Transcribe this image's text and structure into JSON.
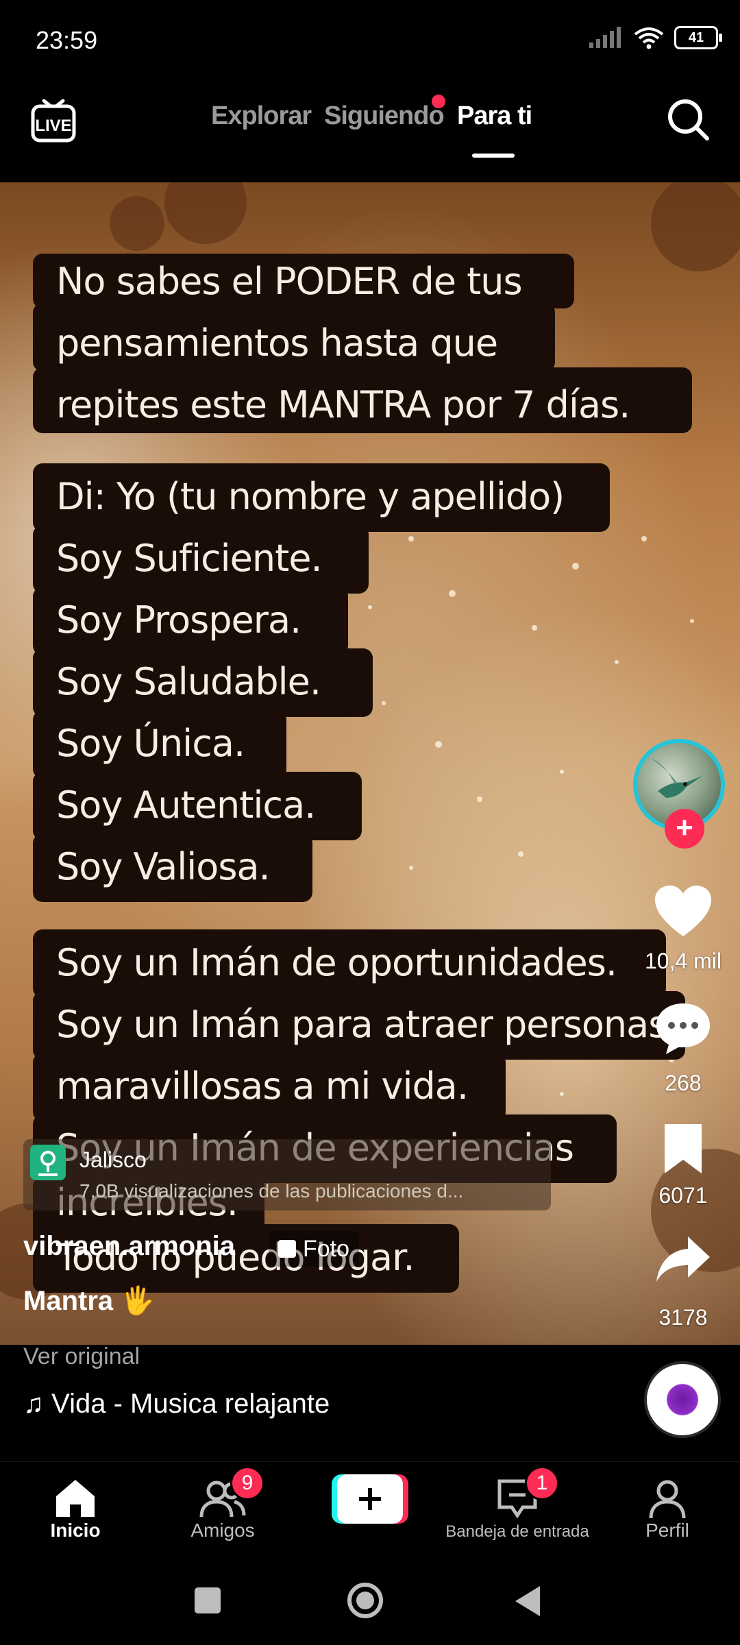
{
  "status": {
    "time": "23:59",
    "battery": "41"
  },
  "top_nav": {
    "live": "LIVE",
    "tabs": [
      {
        "label": "Explorar",
        "active": false
      },
      {
        "label": "Siguiendo",
        "active": false,
        "has_dot": true
      },
      {
        "label": "Para ti",
        "active": true
      }
    ]
  },
  "video": {
    "caption_lines": [
      "No sabes el PODER de tus",
      "pensamientos hasta que",
      "repites este MANTRA por 7 días.",
      "Di: Yo (tu nombre y apellido)",
      "Soy Suficiente.",
      "Soy Prospera.",
      "Soy Saludable.",
      "Soy Única.",
      "Soy Autentica.",
      "Soy Valiosa.",
      "Soy un Imán de oportunidades.",
      "Soy un Imán para atraer personas",
      "maravillosas a mi vida.",
      "Soy un Imán de experiencias",
      "increíbles.",
      "Todo lo puedo logar."
    ]
  },
  "actions": {
    "likes": "10,4 mil",
    "comments": "268",
    "saves": "6071",
    "shares": "3178"
  },
  "location": {
    "name": "Jalisco",
    "subtitle": "7,0B visualizaciones de las publicaciones d..."
  },
  "post": {
    "author": "vibraen.armonia",
    "type_chip": "Foto",
    "description": "Mantra 🖐",
    "ver_original": "Ver original",
    "music": "♫ Vida - Musica relajante"
  },
  "bottom_nav": {
    "inicio": "Inicio",
    "amigos": "Amigos",
    "amigos_badge": "9",
    "bandeja": "Bandeja de entrada",
    "bandeja_badge": "1",
    "perfil": "Perfil"
  },
  "colors": {
    "accent": "#fe2c55",
    "cyan": "#25f4ee"
  }
}
